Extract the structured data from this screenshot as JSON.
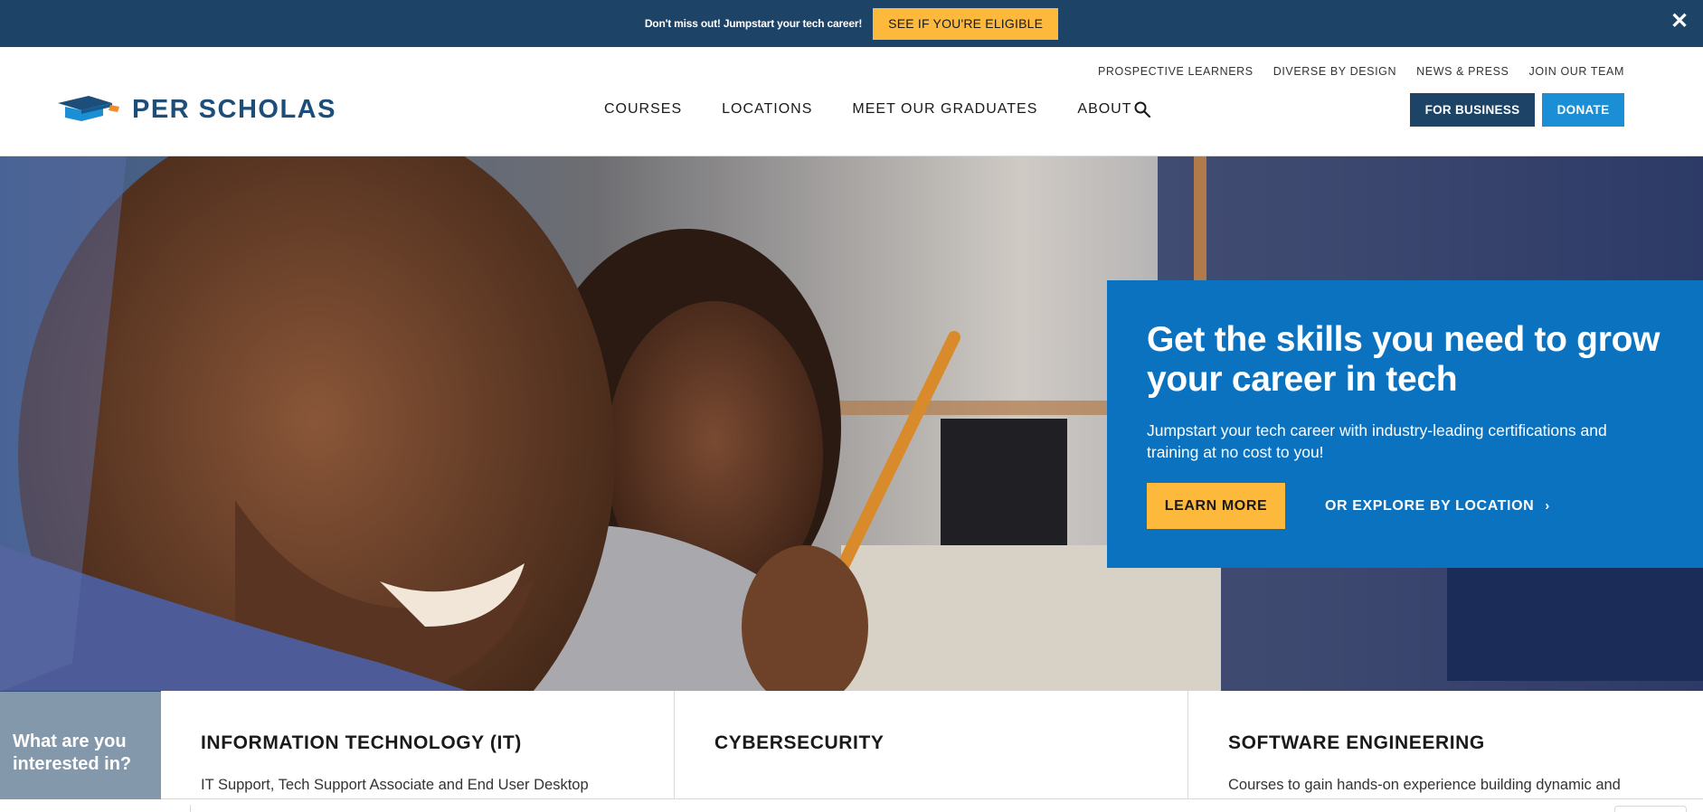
{
  "promo": {
    "text": "Don't miss out! Jumpstart your tech career!",
    "button_label": "SEE IF YOU'RE ELIGIBLE",
    "close_glyph": "✕",
    "close_icon": "close-icon"
  },
  "header": {
    "brand": "PER SCHOLAS",
    "logo_icon": "graduation-cap-logo-icon",
    "utility_links": [
      "PROSPECTIVE LEARNERS",
      "DIVERSE BY DESIGN",
      "NEWS & PRESS",
      "JOIN OUR TEAM"
    ],
    "nav": [
      "COURSES",
      "LOCATIONS",
      "MEET OUR GRADUATES",
      "ABOUT"
    ],
    "search_icon": "search-icon",
    "for_business_label": "FOR BUSINESS",
    "donate_label": "DONATE"
  },
  "hero": {
    "title": "Get the skills you need to grow your career in tech",
    "subtitle": "Jumpstart your tech career with industry-leading certifications and training at no cost to you!",
    "learn_more_label": "LEARN MORE",
    "explore_label": "OR EXPLORE BY LOCATION",
    "explore_chevron": "›"
  },
  "interest": {
    "label": "What are you interested in?",
    "courses": [
      {
        "title": "INFORMATION TECHNOLOGY (IT)",
        "desc": "IT Support, Tech Support Associate and End User Desktop"
      },
      {
        "title": "CYBERSECURITY",
        "desc": ""
      },
      {
        "title": "SOFTWARE ENGINEERING",
        "desc": "Courses to gain hands-on experience building dynamic and"
      }
    ]
  },
  "colors": {
    "navy": "#1d4466",
    "brand_blue": "#1d4e7a",
    "hero_card": "#0b72c0",
    "accent_yellow": "#fdb93b",
    "donate_blue": "#1a8fd6"
  }
}
